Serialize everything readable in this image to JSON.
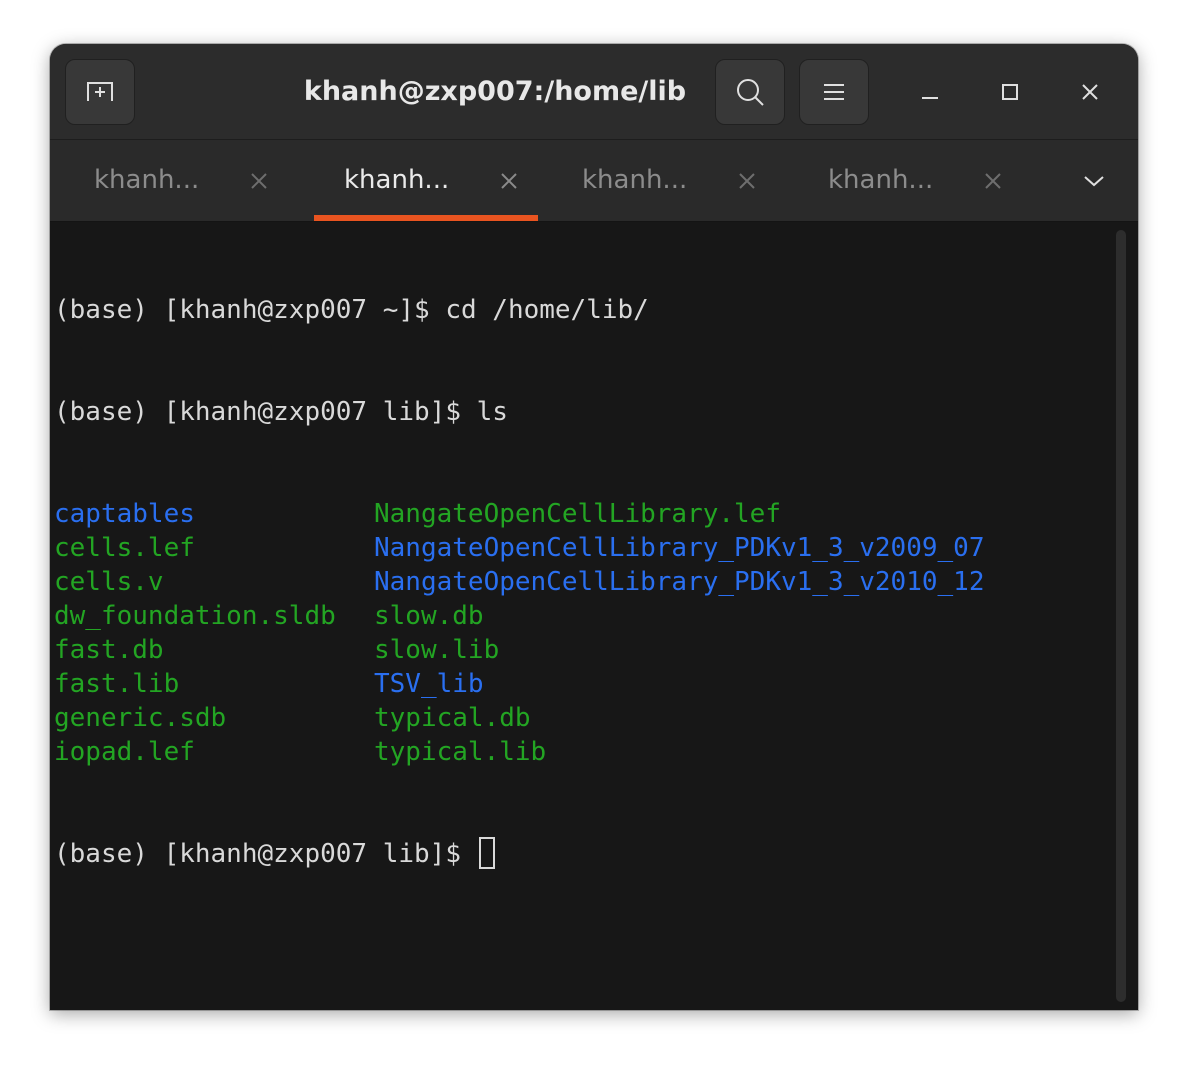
{
  "window": {
    "title": "khanh@zxp007:/home/lib"
  },
  "header": {
    "new_tab_icon": "new-tab-icon",
    "search_icon": "search-icon",
    "menu_icon": "hamburger-menu-icon"
  },
  "window_controls": [
    "minimize-icon",
    "maximize-icon",
    "close-icon"
  ],
  "tabs": [
    {
      "label": "khanh...",
      "active": false
    },
    {
      "label": "khanh...",
      "active": true
    },
    {
      "label": "khanh...",
      "active": false
    },
    {
      "label": "khanh...",
      "active": false
    }
  ],
  "terminal": {
    "lines": [
      "(base) [khanh@zxp007 ~]$ cd /home/lib/",
      "(base) [khanh@zxp007 lib]$ ls"
    ],
    "listing": [
      [
        {
          "name": "captables",
          "kind": "directory"
        },
        {
          "name": "NangateOpenCellLibrary.lef",
          "kind": "file"
        }
      ],
      [
        {
          "name": "cells.lef",
          "kind": "file"
        },
        {
          "name": "NangateOpenCellLibrary_PDKv1_3_v2009_07",
          "kind": "directory"
        }
      ],
      [
        {
          "name": "cells.v",
          "kind": "file"
        },
        {
          "name": "NangateOpenCellLibrary_PDKv1_3_v2010_12",
          "kind": "directory"
        }
      ],
      [
        {
          "name": "dw_foundation.sldb",
          "kind": "file"
        },
        {
          "name": "slow.db",
          "kind": "file"
        }
      ],
      [
        {
          "name": "fast.db",
          "kind": "file"
        },
        {
          "name": "slow.lib",
          "kind": "file"
        }
      ],
      [
        {
          "name": "fast.lib",
          "kind": "file"
        },
        {
          "name": "TSV_lib",
          "kind": "directory"
        }
      ],
      [
        {
          "name": "generic.sdb",
          "kind": "file"
        },
        {
          "name": "typical.db",
          "kind": "file"
        }
      ],
      [
        {
          "name": "iopad.lef",
          "kind": "file"
        },
        {
          "name": "typical.lib",
          "kind": "file"
        }
      ]
    ],
    "prompt": "(base) [khanh@zxp007 lib]$ "
  },
  "colors": {
    "file": "#23a523",
    "directory": "#2a6ff0",
    "accent": "#e95420"
  }
}
